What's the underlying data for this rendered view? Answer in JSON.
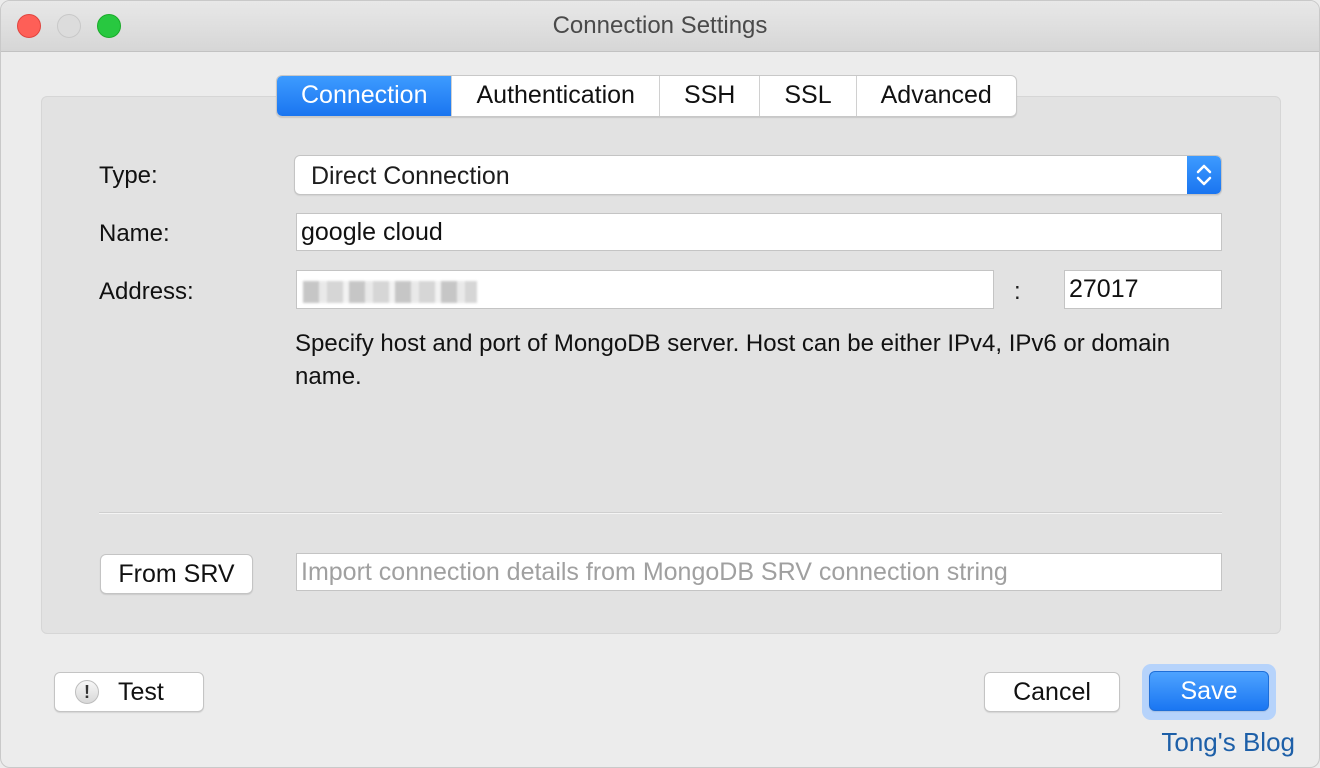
{
  "window": {
    "title": "Connection Settings"
  },
  "tabs": [
    {
      "label": "Connection",
      "active": true
    },
    {
      "label": "Authentication",
      "active": false
    },
    {
      "label": "SSH",
      "active": false
    },
    {
      "label": "SSL",
      "active": false
    },
    {
      "label": "Advanced",
      "active": false
    }
  ],
  "form": {
    "type_label": "Type:",
    "type_value": "Direct Connection",
    "name_label": "Name:",
    "name_value": "google cloud",
    "address_label": "Address:",
    "address_separator": ":",
    "port_value": "27017",
    "help_text": "Specify host and port of MongoDB server. Host can be either IPv4, IPv6 or domain name."
  },
  "srv": {
    "button_label": "From SRV",
    "placeholder": "Import connection details from MongoDB SRV connection string"
  },
  "footer": {
    "test_label": "Test",
    "test_icon_glyph": "!",
    "cancel_label": "Cancel",
    "save_label": "Save"
  },
  "watermark": "Tong's Blog",
  "colors": {
    "accent": "#1a75f0",
    "close": "#fe5f57",
    "maximize": "#28c840"
  }
}
